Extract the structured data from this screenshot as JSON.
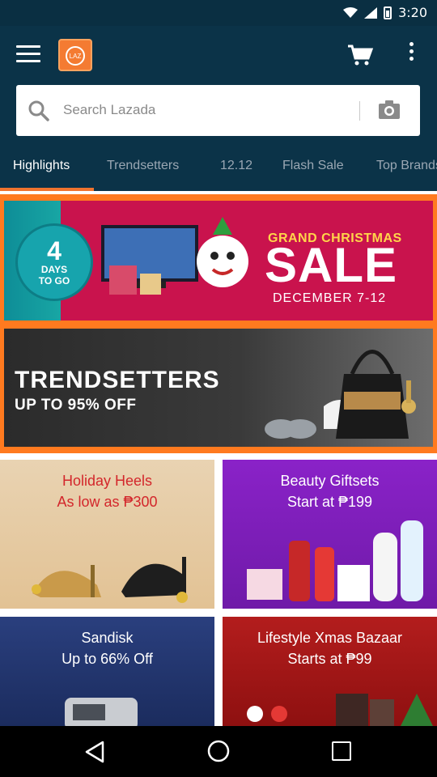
{
  "status_bar": {
    "time": "3:20"
  },
  "app_bar": {
    "menu_icon": "hamburger-menu-icon",
    "logo_text": "LAZ",
    "cart_icon": "shopping-cart-icon",
    "more_icon": "more-vertical-icon"
  },
  "search": {
    "placeholder": "Search Lazada",
    "search_icon": "search-icon",
    "camera_icon": "camera-icon"
  },
  "tabs": [
    {
      "label": "Highlights",
      "active": true
    },
    {
      "label": "Trendsetters",
      "active": false
    },
    {
      "label": "12.12",
      "active": false
    },
    {
      "label": "Flash Sale",
      "active": false
    },
    {
      "label": "Top Brands",
      "active": false
    }
  ],
  "banners": {
    "xmas": {
      "days_num": "4",
      "days_text_1": "DAYS",
      "days_text_2": "TO GO",
      "title": "GRAND CHRISTMAS",
      "sale": "SALE",
      "dates": "DECEMBER 7-12"
    },
    "trend": {
      "title": "TRENDSETTERS",
      "subtitle": "UP TO 95% OFF"
    }
  },
  "tiles": [
    {
      "line1": "Holiday Heels",
      "line2": "As low as ₱300"
    },
    {
      "line1": "Beauty Giftsets",
      "line2": "Start at ₱199"
    },
    {
      "line1": "Sandisk",
      "line2": "Up to 66% Off"
    },
    {
      "line1": "Lifestyle Xmas Bazaar",
      "line2": "Starts at ₱99"
    }
  ],
  "colors": {
    "app_bar": "#0b3348",
    "accent": "#f0732e",
    "promo_border": "#ff7a1f"
  }
}
